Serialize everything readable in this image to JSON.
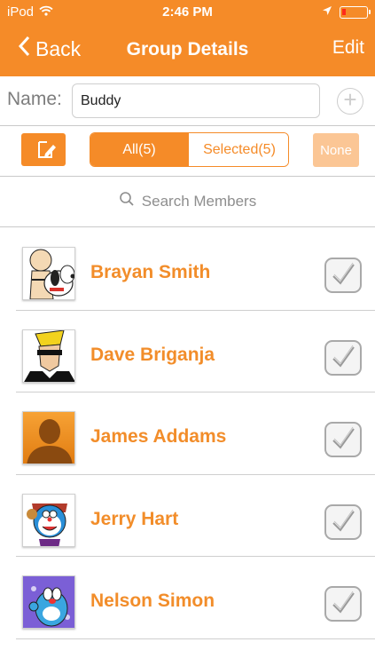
{
  "status_bar": {
    "carrier": "iPod",
    "time": "2:46 PM"
  },
  "nav": {
    "back_label": "Back",
    "title": "Group Details",
    "edit_label": "Edit"
  },
  "name_field": {
    "label": "Name:",
    "value": "Buddy"
  },
  "filter": {
    "all_label": "All(5)",
    "selected_label": "Selected(5)",
    "none_label": "None"
  },
  "search": {
    "placeholder": "Search Members"
  },
  "members": [
    {
      "name": "Brayan Smith",
      "avatar": "snoopy-avatar",
      "checked": true
    },
    {
      "name": "Dave Briganja",
      "avatar": "johnny-bravo-avatar",
      "checked": true
    },
    {
      "name": "James Addams",
      "avatar": "default-person-avatar",
      "checked": true
    },
    {
      "name": "Jerry Hart",
      "avatar": "doraemon-avatar",
      "checked": true
    },
    {
      "name": "Nelson Simon",
      "avatar": "oggy-avatar",
      "checked": true
    }
  ],
  "colors": {
    "accent": "#f58b28",
    "accent_light": "#fbc695",
    "member_text": "#f28d2a"
  }
}
